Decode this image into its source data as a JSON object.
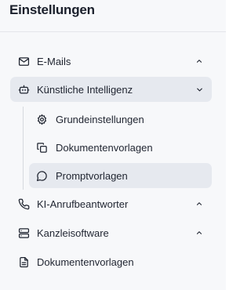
{
  "header": {
    "title": "Einstellungen"
  },
  "nav": {
    "emails": {
      "label": "E-Mails",
      "icon": "mail-icon",
      "state": "collapsed"
    },
    "ki": {
      "label": "Künstliche Intelligenz",
      "icon": "bot-icon",
      "state": "expanded",
      "children": [
        {
          "label": "Grundeinstellungen",
          "icon": "gear-icon"
        },
        {
          "label": "Dokumentenvorlagen",
          "icon": "copy-icon"
        },
        {
          "label": "Promptvorlagen",
          "icon": "message-circle-icon",
          "active": true
        }
      ]
    },
    "phone": {
      "label": "KI-Anrufbeantworter",
      "icon": "phone-icon",
      "state": "collapsed"
    },
    "kanzlei": {
      "label": "Kanzleisoftware",
      "icon": "server-icon",
      "state": "collapsed"
    },
    "docs": {
      "label": "Dokumentenvorlagen",
      "icon": "file-text-icon"
    }
  },
  "colors": {
    "panel_bg": "#f7f8fa",
    "active_bg": "#e6e9ef",
    "text": "#1f2430"
  }
}
